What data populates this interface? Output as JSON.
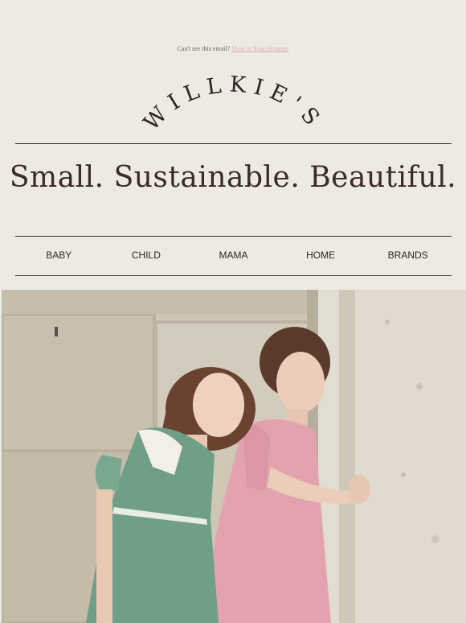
{
  "preheader": {
    "text": "Can't see this email?",
    "link": "View in Your Browser"
  },
  "brand": {
    "logo_text": "WILLKIE'S"
  },
  "tagline": "Small. Sustainable. Beautiful.",
  "nav": {
    "items": [
      "BABY",
      "CHILD",
      "MAMA",
      "HOME",
      "BRANDS"
    ]
  },
  "colors": {
    "background": "#edebe1",
    "text_dark": "#3b2a2b",
    "link_pink": "#d6a9b8"
  },
  "hero": {
    "image": "two-girls-in-dresses-photo"
  }
}
